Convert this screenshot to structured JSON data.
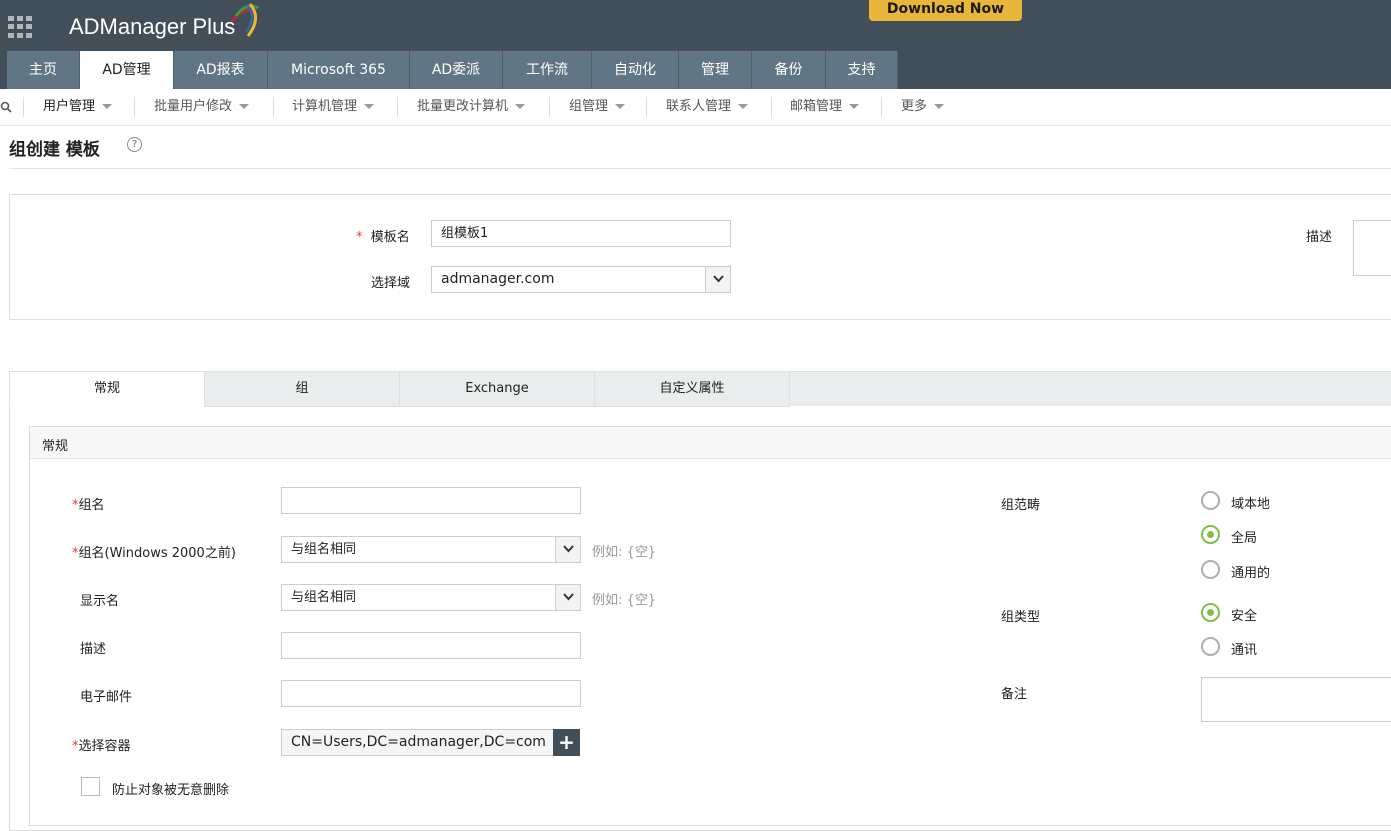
{
  "header": {
    "app_name": "ADManager Plus",
    "download_label": "Download Now"
  },
  "main_tabs": [
    "主页",
    "AD管理",
    "AD报表",
    "Microsoft 365",
    "AD委派",
    "工作流",
    "自动化",
    "管理",
    "备份",
    "支持"
  ],
  "sub_nav": [
    "用户管理",
    "批量用户修改",
    "计算机管理",
    "批量更改计算机",
    "组管理",
    "联系人管理",
    "邮箱管理",
    "更多"
  ],
  "page_title": "组创建 模板",
  "template": {
    "name_label": "模板名",
    "name_value": "组模板1",
    "domain_label": "选择域",
    "domain_value": "admanager.com",
    "desc_label": "描述"
  },
  "tabs": [
    "常规",
    "组",
    "Exchange",
    "自定义属性"
  ],
  "section": {
    "title": "常规",
    "fields": {
      "group_name": {
        "label": "组名",
        "value": ""
      },
      "pre2000": {
        "label": "组名(Windows 2000之前)",
        "value": "与组名相同",
        "hint": "例如: {空}"
      },
      "display_name": {
        "label": "显示名",
        "value": "与组名相同",
        "hint": "例如: {空}"
      },
      "description": {
        "label": "描述",
        "value": ""
      },
      "email": {
        "label": "电子邮件",
        "value": ""
      },
      "container": {
        "label": "选择容器",
        "value": "CN=Users,DC=admanager,DC=com"
      },
      "protect": {
        "label": "防止对象被无意删除",
        "checked": false
      }
    },
    "scope": {
      "label": "组范畴",
      "options": [
        "域本地",
        "全局",
        "通用的"
      ],
      "selected": "全局"
    },
    "type": {
      "label": "组类型",
      "options": [
        "安全",
        "通讯"
      ],
      "selected": "安全"
    },
    "notes": {
      "label": "备注",
      "value": ""
    }
  },
  "colors": {
    "header": "#434f58",
    "tab": "#617684",
    "accent": "#e8b63a",
    "radio": "#7cc04b"
  }
}
